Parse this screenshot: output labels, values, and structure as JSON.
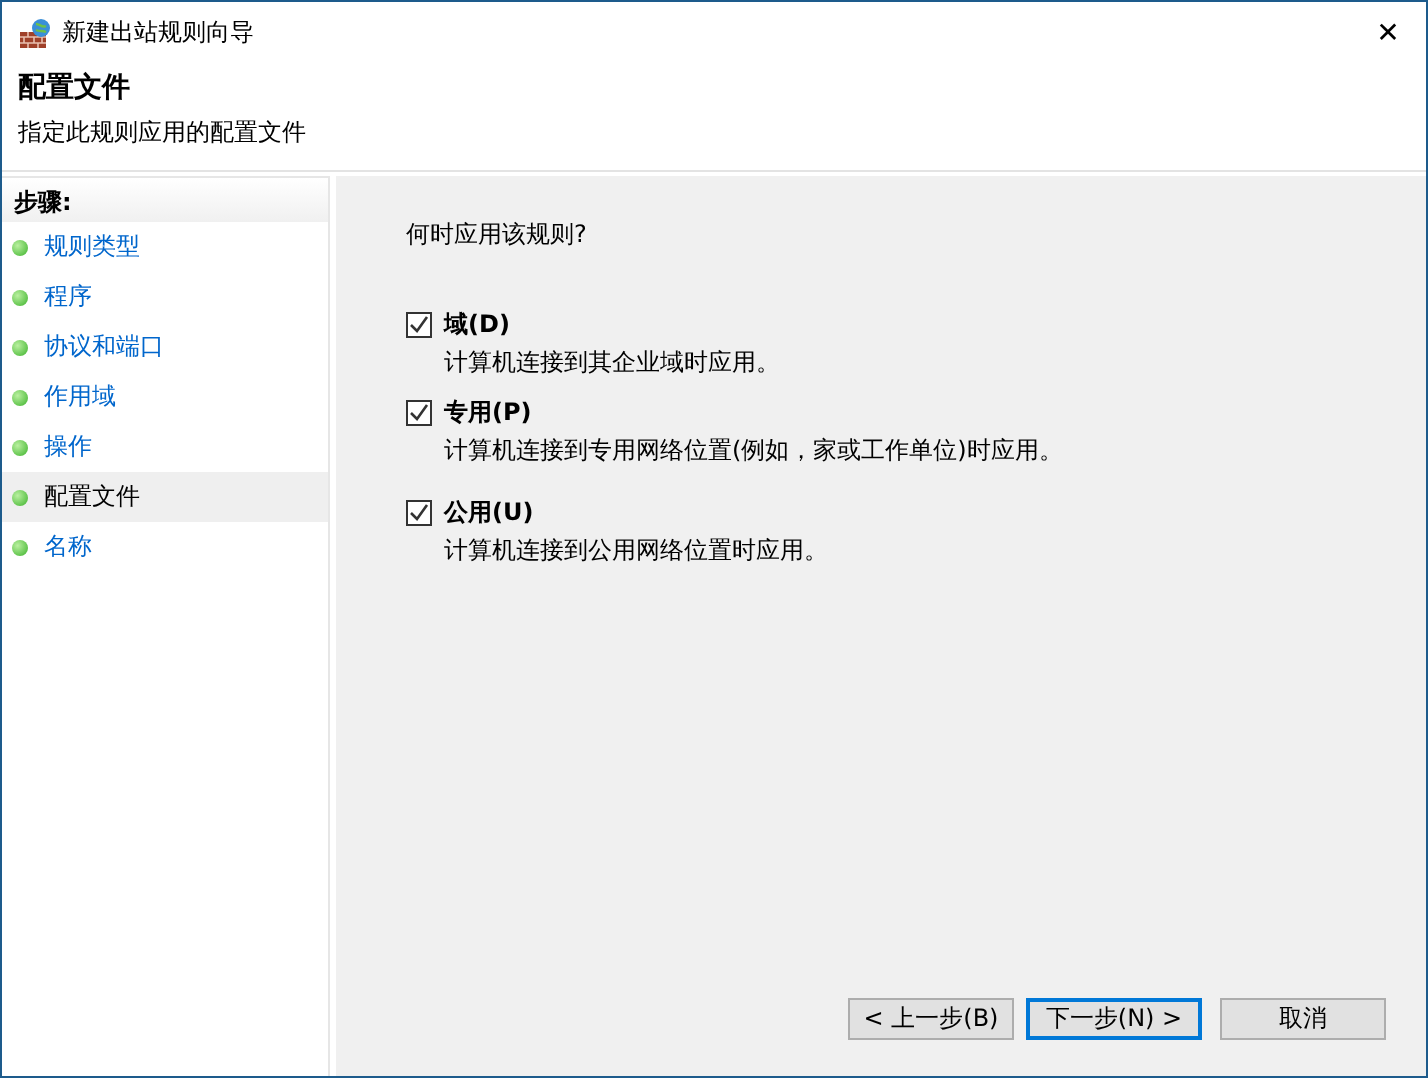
{
  "window": {
    "title": "新建出站规则向导"
  },
  "header": {
    "title": "配置文件",
    "subtitle": "指定此规则应用的配置文件"
  },
  "steps": {
    "heading": "步骤:",
    "items": [
      {
        "label": "规则类型",
        "selected": false
      },
      {
        "label": "程序",
        "selected": false
      },
      {
        "label": "协议和端口",
        "selected": false
      },
      {
        "label": "作用域",
        "selected": false
      },
      {
        "label": "操作",
        "selected": false
      },
      {
        "label": "配置文件",
        "selected": true
      },
      {
        "label": "名称",
        "selected": false
      }
    ]
  },
  "question": "何时应用该规则?",
  "options": [
    {
      "label": "域(D)",
      "description": "计算机连接到其企业域时应用。",
      "checked": true
    },
    {
      "label": "专用(P)",
      "description": "计算机连接到专用网络位置(例如，家或工作单位)时应用。",
      "checked": true
    },
    {
      "label": "公用(U)",
      "description": "计算机连接到公用网络位置时应用。",
      "checked": true
    }
  ],
  "buttons": [
    {
      "label": "< 上一步(B)",
      "default": false
    },
    {
      "label": "下一步(N) >",
      "default": true
    },
    {
      "label": "取消",
      "default": false
    }
  ],
  "close_glyph": "✕"
}
